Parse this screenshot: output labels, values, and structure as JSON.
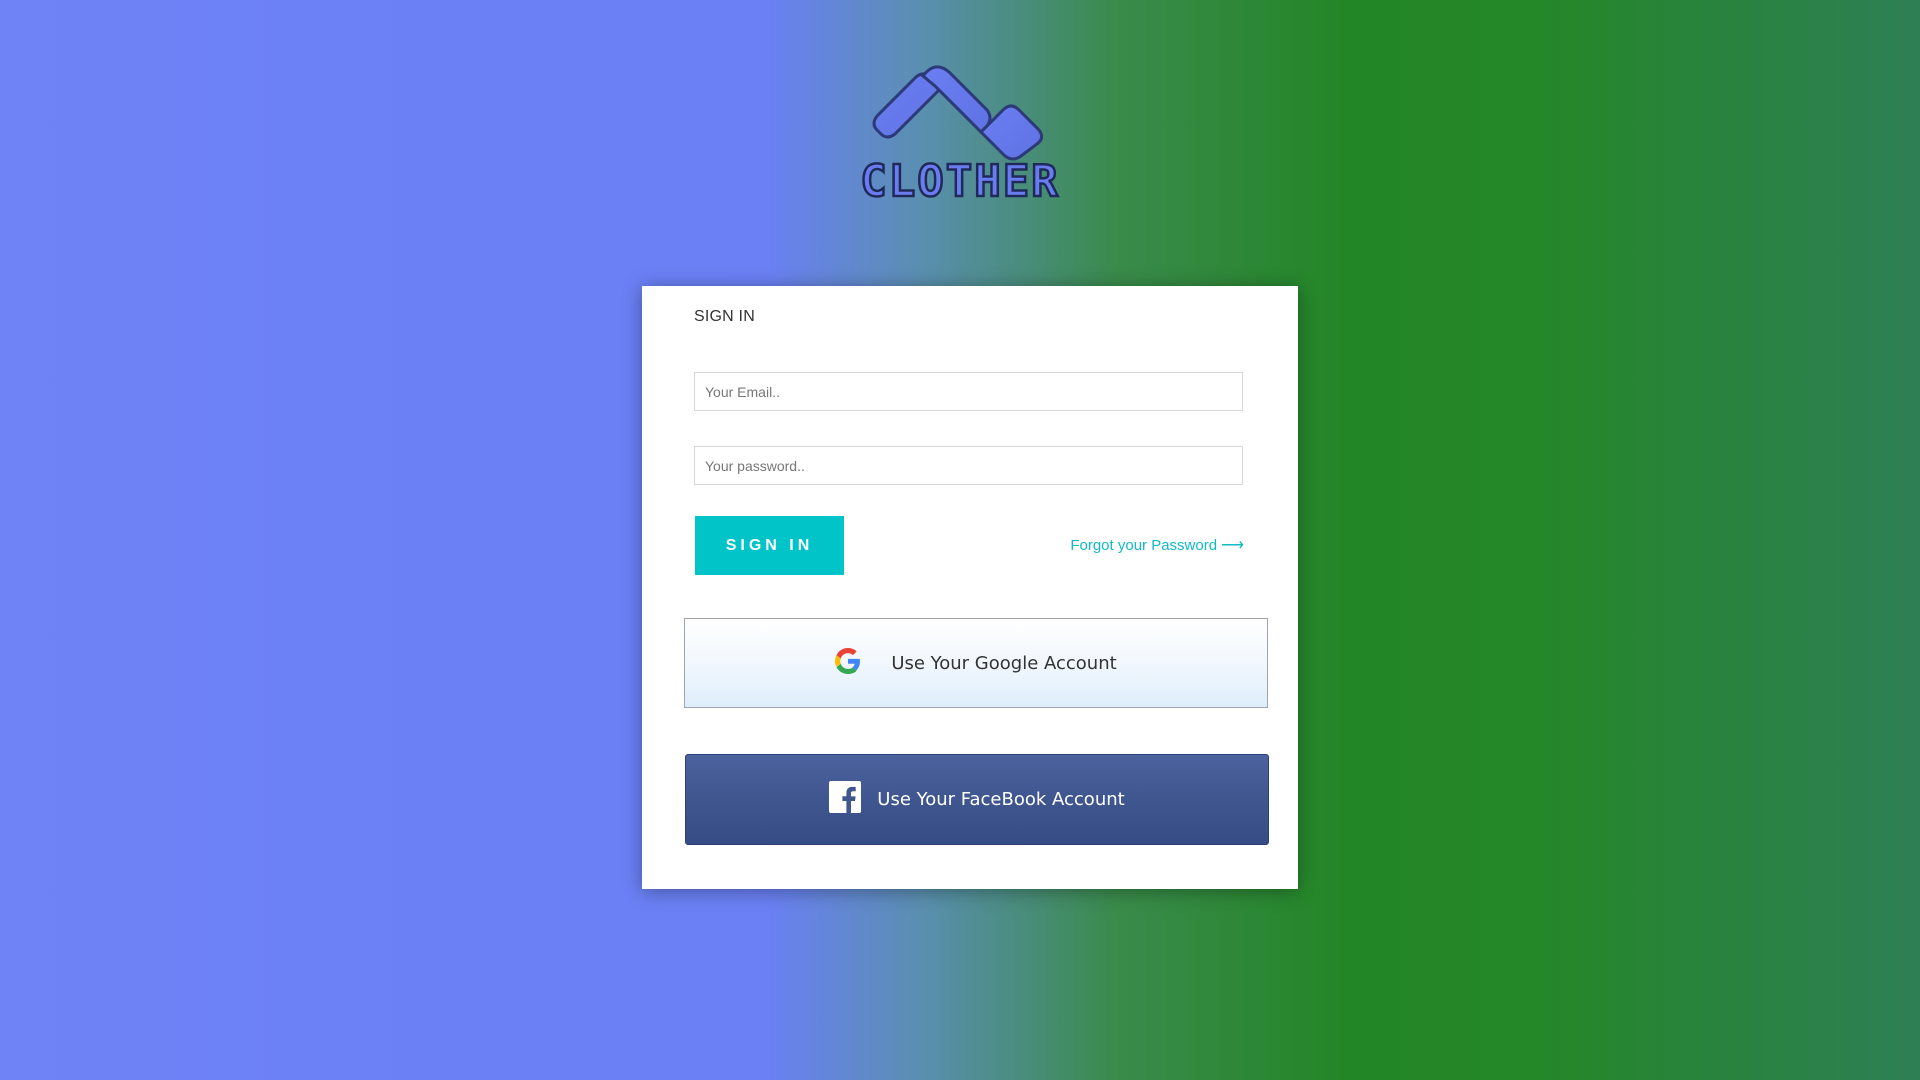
{
  "brand": {
    "name": "CLOTHER",
    "logo_color": "#6a7df0"
  },
  "signin": {
    "title": "SIGN IN",
    "email_placeholder": "Your Email..",
    "password_placeholder": "Your password..",
    "submit_label": "SIGN IN",
    "forgot_label": "Forgot your Password",
    "forgot_icon": "arrow-right-icon"
  },
  "social": {
    "google_label": "Use Your Google Account",
    "google_icon": "google-icon",
    "facebook_label": "Use Your FaceBook Account",
    "facebook_icon": "facebook-icon"
  },
  "colors": {
    "accent": "#00c4c8",
    "link": "#13b9c7",
    "facebook": "#3f568f"
  }
}
